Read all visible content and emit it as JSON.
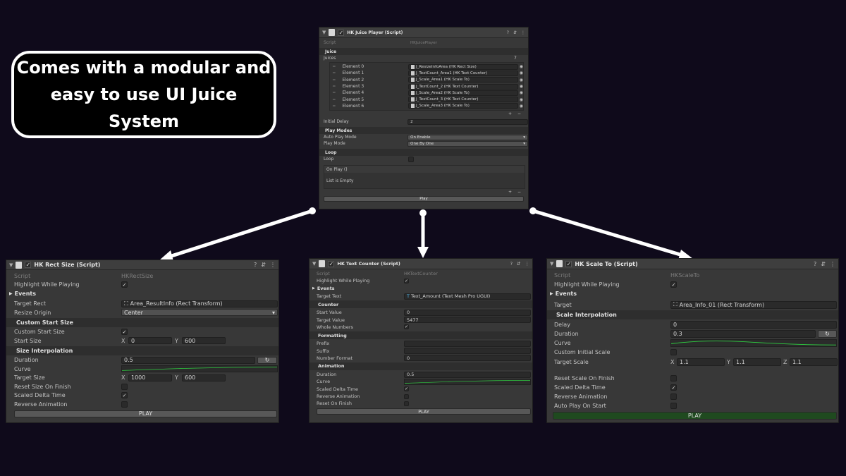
{
  "headline": {
    "line1": "Comes with a modular and",
    "line2": "easy to use UI Juice System"
  },
  "colors": {
    "background": "#0f0a1b",
    "panel": "#383838",
    "curve": "#2ecc40",
    "play_green": "#1f4a1f"
  },
  "juice_player": {
    "title": "HK Juice Player (Script)",
    "script_label": "Script",
    "script_value": "HKJuicePlayer",
    "juice_section": "Juice",
    "juices_label": "Juices",
    "juices_count": "7",
    "elements": [
      {
        "label": "Element 0",
        "value": "J_ResizeInfoArea (HK Rect Size)"
      },
      {
        "label": "Element 1",
        "value": "J_TextCount_Area1 (HK Text Counter)"
      },
      {
        "label": "Element 2",
        "value": "J_Scale_Area1 (HK Scale To)"
      },
      {
        "label": "Element 3",
        "value": "J_TextCount_2 (HK Text Counter)"
      },
      {
        "label": "Element 4",
        "value": "J_Scale_Area2 (HK Scale To)"
      },
      {
        "label": "Element 5",
        "value": "J_TextCount_3 (HK Text Counter)"
      },
      {
        "label": "Element 6",
        "value": "J_Scale_Area3 (HK Scale To)"
      }
    ],
    "initial_delay_label": "Initial Delay",
    "initial_delay_value": "2",
    "play_modes_section": "Play Modes",
    "auto_play_mode_label": "Auto Play Mode",
    "auto_play_mode_value": "On Enable",
    "play_mode_label": "Play Mode",
    "play_mode_value": "One By One",
    "loop_section": "Loop",
    "loop_label": "Loop",
    "on_play_label": "On Play ()",
    "list_empty": "List is Empty",
    "play_label": "Play"
  },
  "rect_size": {
    "title": "HK Rect Size (Script)",
    "script_label": "Script",
    "script_value": "HKRectSize",
    "highlight_label": "Highlight While Playing",
    "events_label": "Events",
    "target_rect_label": "Target Rect",
    "target_rect_value": "Area_ResultInfo (Rect Transform)",
    "resize_origin_label": "Resize Origin",
    "resize_origin_value": "Center",
    "custom_start_section": "Custom Start Size",
    "custom_start_size_label": "Custom Start Size",
    "start_size_label": "Start Size",
    "start_x": "0",
    "start_y": "600",
    "size_interp_section": "Size Interpolation",
    "duration_label": "Duration",
    "duration_value": "0.5",
    "curve_label": "Curve",
    "target_size_label": "Target Size",
    "target_x": "1000",
    "target_y": "600",
    "reset_label": "Reset Size On Finish",
    "scaled_label": "Scaled Delta Time",
    "reverse_label": "Reverse Animation",
    "play_label": "PLAY",
    "x_label": "X",
    "y_label": "Y"
  },
  "text_counter": {
    "title": "HK Text Counter (Script)",
    "script_label": "Script",
    "script_value": "HKTextCounter",
    "highlight_label": "Highlight While Playing",
    "events_label": "Events",
    "target_text_label": "Target Text",
    "target_text_value": "Text_Amount (Text Mesh Pro UGUI)",
    "counter_section": "Counter",
    "start_value_label": "Start Value",
    "start_value": "0",
    "target_value_label": "Target Value",
    "target_value": "5477",
    "whole_numbers_label": "Whole Numbers",
    "formatting_section": "Formatting",
    "prefix_label": "Prefix",
    "suffix_label": "Suffix",
    "number_format_label": "Number Format",
    "number_format_value": "0",
    "animation_section": "Animation",
    "duration_label": "Duration",
    "duration_value": "0.5",
    "curve_label": "Curve",
    "scaled_label": "Scaled Delta Time",
    "reverse_label": "Reverse Animation",
    "reset_label": "Reset On Finish",
    "play_label": "PLAY"
  },
  "scale_to": {
    "title": "HK Scale To (Script)",
    "script_label": "Script",
    "script_value": "HKScaleTo",
    "highlight_label": "Highlight While Playing",
    "events_label": "Events",
    "target_label": "Target",
    "target_value": "Area_Info_01 (Rect Transform)",
    "scale_interp_section": "Scale Interpolation",
    "delay_label": "Delay",
    "delay_value": "0",
    "duration_label": "Duration",
    "duration_value": "0.3",
    "curve_label": "Curve",
    "custom_initial_label": "Custom Initial Scale",
    "target_scale_label": "Target Scale",
    "scale_x": "1.1",
    "scale_y": "1.1",
    "scale_z": "1.1",
    "reset_label": "Reset Scale On Finish",
    "scaled_label": "Scaled Delta Time",
    "reverse_label": "Reverse Animation",
    "auto_play_label": "Auto Play On Start",
    "play_label": "PLAY",
    "x_label": "X",
    "y_label": "Y",
    "z_label": "Z"
  }
}
